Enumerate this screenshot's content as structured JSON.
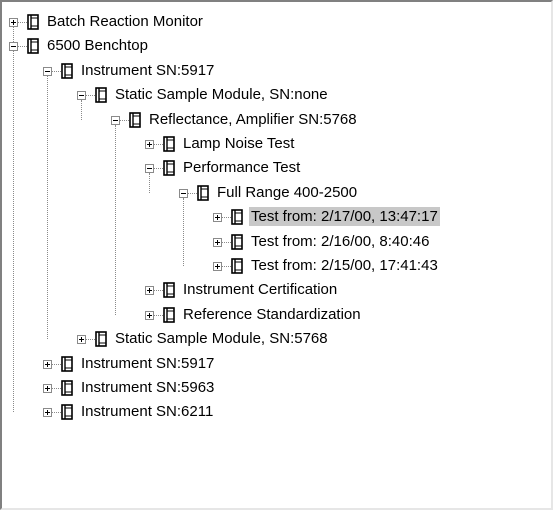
{
  "tree": {
    "nodes": [
      {
        "label": "Batch Reaction Monitor",
        "expanded": false,
        "level": 0
      },
      {
        "label": "6500 Benchtop",
        "expanded": true,
        "level": 0
      },
      {
        "label": "Instrument SN:5917",
        "expanded": true,
        "level": 1
      },
      {
        "label": "Static Sample Module, SN:none",
        "expanded": true,
        "level": 2
      },
      {
        "label": "Reflectance, Amplifier SN:5768",
        "expanded": true,
        "level": 3
      },
      {
        "label": "Lamp Noise Test",
        "expanded": false,
        "level": 4
      },
      {
        "label": "Performance Test",
        "expanded": true,
        "level": 4
      },
      {
        "label": "Full Range 400-2500",
        "expanded": true,
        "level": 5
      },
      {
        "label": "Test from: 2/17/00, 13:47:17",
        "expanded": false,
        "level": 6,
        "selected": true
      },
      {
        "label": "Test from: 2/16/00, 8:40:46",
        "expanded": false,
        "level": 6
      },
      {
        "label": "Test from: 2/15/00, 17:41:43",
        "expanded": false,
        "level": 6
      },
      {
        "label": "Instrument Certification",
        "expanded": false,
        "level": 4
      },
      {
        "label": "Reference Standardization",
        "expanded": false,
        "level": 4
      },
      {
        "label": "Static Sample Module, SN:5768",
        "expanded": false,
        "level": 2
      },
      {
        "label": "Instrument SN:5917",
        "expanded": false,
        "level": 1
      },
      {
        "label": "Instrument SN:5963",
        "expanded": false,
        "level": 1
      },
      {
        "label": "Instrument SN:6211",
        "expanded": false,
        "level": 1
      }
    ],
    "icon": "instrument-document-icon",
    "colors": {
      "selection": "#c8c8c8",
      "connector": "#8a8a8a",
      "icon_fill": "#ffffff",
      "icon_stroke": "#000000"
    }
  }
}
